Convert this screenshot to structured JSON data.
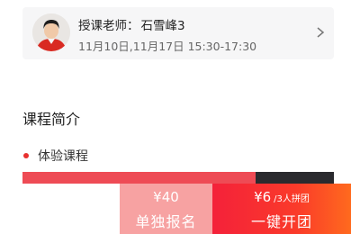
{
  "teacher": {
    "label": "授课老师：",
    "name": "石雪峰3",
    "schedule": "11月10日,11月17日 15:30-17:30"
  },
  "intro": {
    "title": "课程简介",
    "course_type": "体验课程"
  },
  "actions": {
    "single": {
      "price": "¥40",
      "label": "单独报名"
    },
    "group": {
      "price": "¥6",
      "note": "/3人拼团",
      "label": "一键开团"
    }
  },
  "colors": {
    "accent": "#e8312f",
    "single_button": "#f7a2a2",
    "group_button_start": "#f4213a",
    "group_button_end": "#ff6a1e"
  },
  "icons": {
    "chevron": "chevron-right-icon",
    "avatar": "teacher-avatar"
  }
}
